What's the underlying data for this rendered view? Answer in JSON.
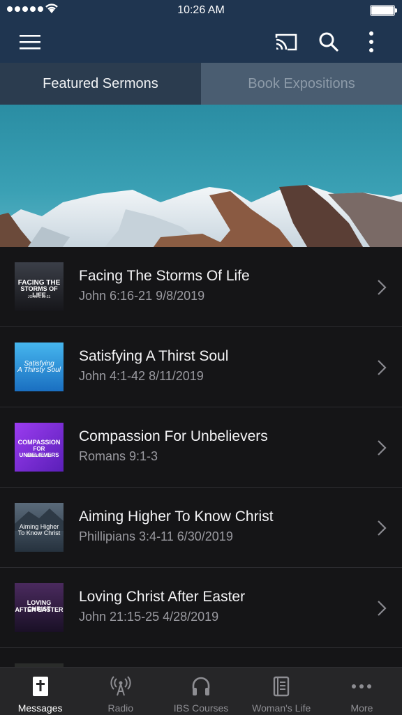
{
  "status_bar": {
    "time": "10:26 AM"
  },
  "app_bar": {
    "menu_icon": "hamburger-menu-icon",
    "cast_icon": "cast-icon",
    "search_icon": "search-icon",
    "more_icon": "vertical-dots-icon"
  },
  "tabs": [
    {
      "label": "Featured Sermons",
      "active": true
    },
    {
      "label": "Book Expositions",
      "active": false
    }
  ],
  "banner": {
    "image": "snowy-mountain-banner"
  },
  "sermons": [
    {
      "title": "Facing The Storms Of Life",
      "subtitle": "John 6:16-21 9/8/2019",
      "thumb_line1": "FACING THE",
      "thumb_line2": "STORMS OF LIFE",
      "thumb_ref": "JOHN 6:16-21",
      "thumb_color": "#2a2a30"
    },
    {
      "title": "Satisfying A Thirst Soul",
      "subtitle": "John 4:1-42 8/11/2019",
      "thumb_line1": "Satisfying",
      "thumb_line2": "A Thirsty Soul",
      "thumb_ref": "",
      "thumb_color": "#1f8fd8"
    },
    {
      "title": "Compassion For Unbelievers",
      "subtitle": "Romans 9:1-3",
      "thumb_line1": "COMPASSION",
      "thumb_line2": "FOR UNBELIEVERS",
      "thumb_ref": "ROMANS 9:1-3",
      "thumb_color": "#7b2fd6"
    },
    {
      "title": "Aiming Higher To Know Christ",
      "subtitle": "Phillipians 3:4-11 6/30/2019",
      "thumb_line1": "Aiming Higher",
      "thumb_line2": "To Know Christ",
      "thumb_ref": "",
      "thumb_color": "#3c4b5a"
    },
    {
      "title": "Loving Christ After Easter",
      "subtitle": "John 21:15-25 4/28/2019",
      "thumb_line1": "LOVING CHRIST",
      "thumb_line2": "AFTER EASTER",
      "thumb_ref": "",
      "thumb_color": "#3a1f4a"
    }
  ],
  "bottom_nav": [
    {
      "label": "Messages",
      "icon": "bible-icon",
      "active": true
    },
    {
      "label": "Radio",
      "icon": "radio-tower-icon",
      "active": false
    },
    {
      "label": "IBS Courses",
      "icon": "headphones-icon",
      "active": false
    },
    {
      "label": "Woman's Life",
      "icon": "book-icon",
      "active": false
    },
    {
      "label": "More",
      "icon": "more-dots-icon",
      "active": false
    }
  ]
}
